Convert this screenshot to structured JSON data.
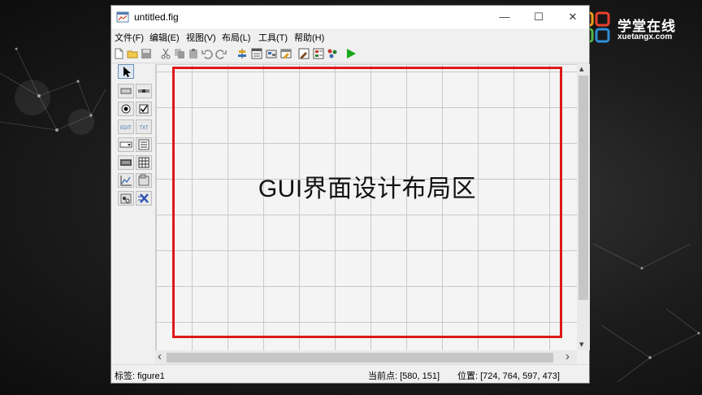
{
  "window": {
    "title": "untitled.fig",
    "minimize_glyph": "—",
    "maximize_glyph": "☐",
    "close_glyph": "✕"
  },
  "menu": [
    {
      "label": "文件(F)"
    },
    {
      "label": "编辑(E)"
    },
    {
      "label": "视图(V)"
    },
    {
      "label": "布局(L)"
    },
    {
      "label": "工具(T)"
    },
    {
      "label": "帮助(H)"
    }
  ],
  "toolbar_icons": [
    "new-file-icon",
    "open-folder-icon",
    "save-icon",
    "cut-icon",
    "copy-icon",
    "paste-icon",
    "undo-icon",
    "redo-icon",
    "align-objects-icon",
    "menu-editor-icon",
    "tab-order-icon",
    "toolbar-editor-icon",
    "editor-icon",
    "property-inspector-icon",
    "object-browser-icon",
    "run-icon"
  ],
  "palette_icons": [
    [
      "select-arrow-icon"
    ],
    [
      "push-button-icon",
      "slider-icon"
    ],
    [
      "radio-button-icon",
      "checkbox-icon"
    ],
    [
      "edit-text-icon",
      "static-text-icon"
    ],
    [
      "popup-menu-icon",
      "listbox-icon"
    ],
    [
      "toggle-button-icon",
      "table-icon"
    ],
    [
      "axes-icon",
      "panel-icon"
    ],
    [
      "button-group-icon",
      "activex-control-icon"
    ]
  ],
  "palette_text": {
    "edit_text": "EDIT",
    "static_text": "TXT"
  },
  "canvas": {
    "annotation": "GUI界面设计布局区"
  },
  "scroll_arrows": {
    "up": "▴",
    "down": "▾",
    "left": "‹",
    "right": "›"
  },
  "status": {
    "tag": "标签: figure1",
    "current_point": "当前点:  [580, 151]",
    "position": "位置: [724, 764, 597, 473]"
  },
  "brand": {
    "name_cn": "学堂在线",
    "name_en": "xuetangx.com"
  },
  "colors": {
    "frame_red": "#e01818",
    "run_green": "#1aa81a",
    "logo_orange": "#f5a019",
    "logo_red": "#e8412e",
    "logo_green": "#52b447",
    "logo_blue": "#2f8fd8"
  }
}
